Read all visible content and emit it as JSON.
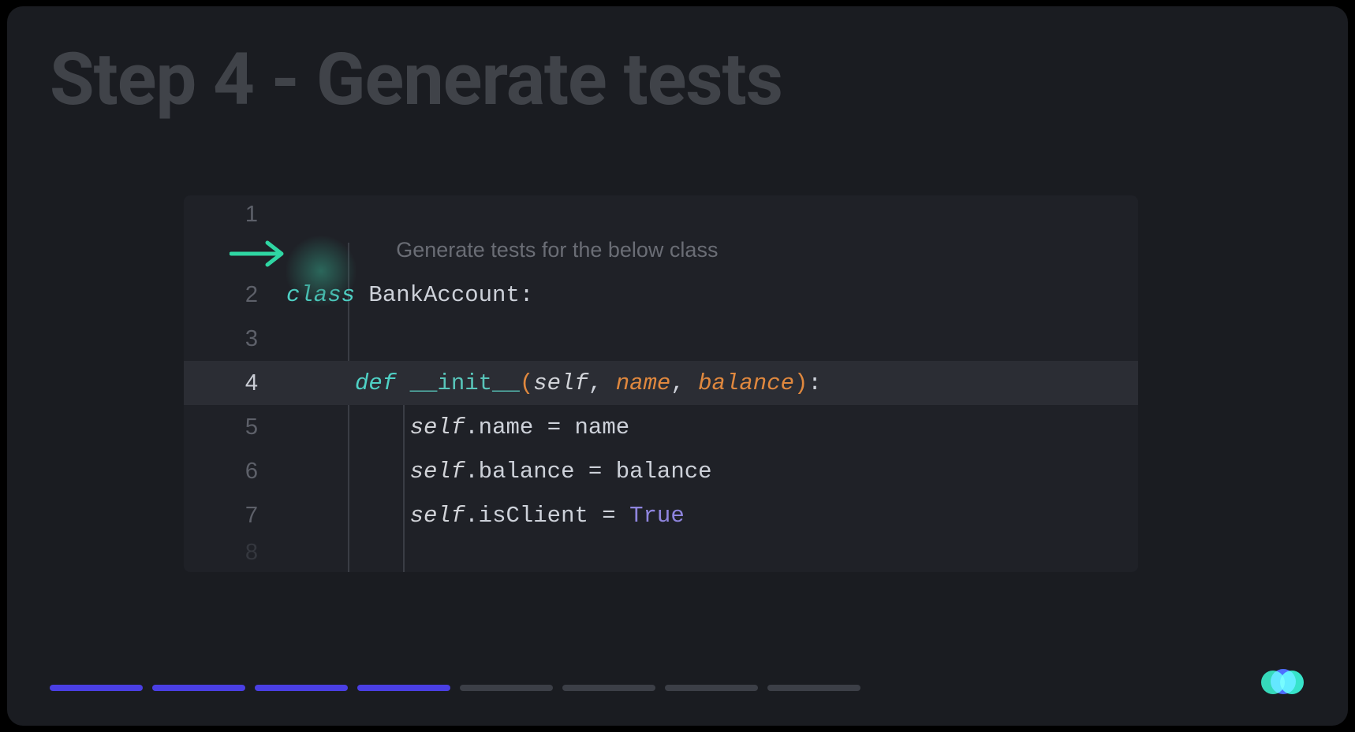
{
  "title": "Step 4 - Generate tests",
  "ghost_prompt": "Generate tests for the below class",
  "code": {
    "line_numbers": [
      "1",
      "2",
      "3",
      "4",
      "5",
      "6",
      "7",
      "8"
    ],
    "highlighted_line_index": 3,
    "tokens": {
      "class_kw": "class",
      "class_name": "BankAccount",
      "colon": ":",
      "def_kw": "def",
      "init_name": "__init__",
      "open_paren": "(",
      "close_paren": ")",
      "self_kw": "self",
      "comma": ",",
      "arg_name": "name",
      "arg_balance": "balance",
      "dot": ".",
      "eq": " = ",
      "prop_name": "name",
      "prop_balance": "balance",
      "prop_isclient": "isClient",
      "val_name": "name",
      "val_balance": "balance",
      "val_true": "True"
    }
  },
  "progress": {
    "total": 8,
    "active": 4
  },
  "colors": {
    "accent_arrow": "#2fd6a3",
    "progress_active": "#4a3fe4",
    "progress_inactive": "#3c3f47"
  }
}
